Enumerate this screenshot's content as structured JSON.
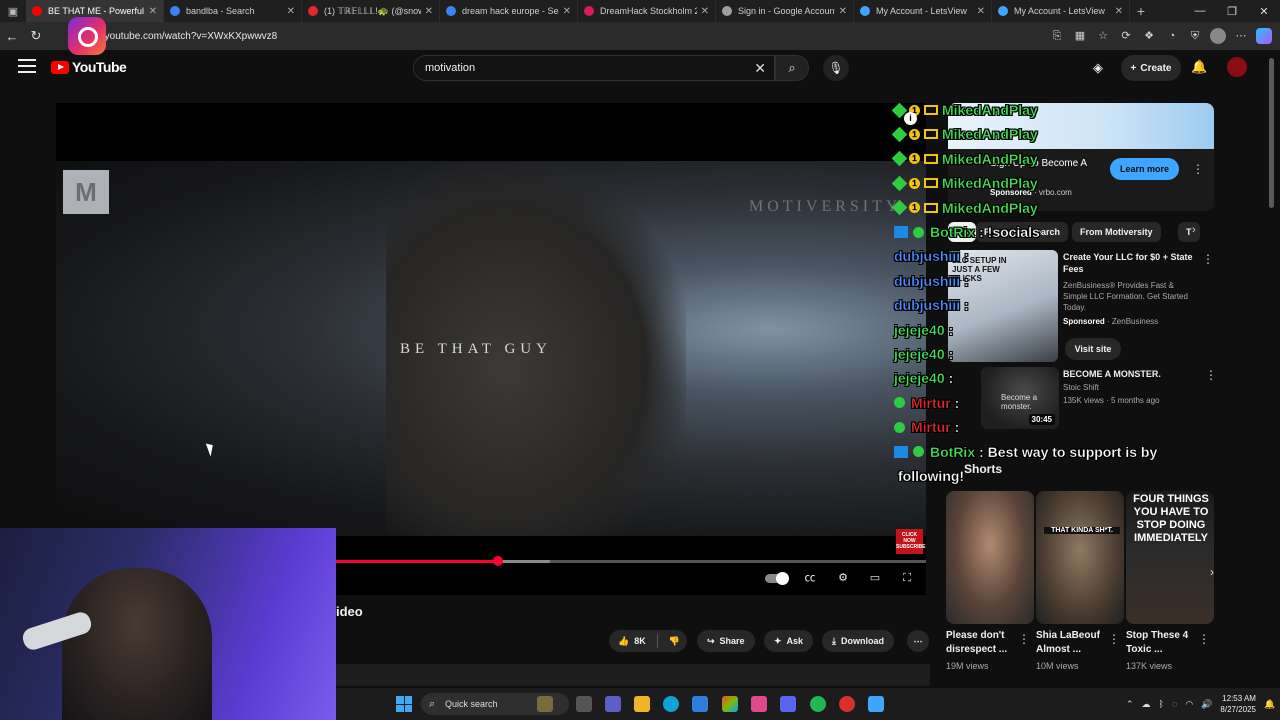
{
  "browser": {
    "tabs": [
      {
        "title": "BE THAT ME - Powerful Mo",
        "color": "#ff0000",
        "active": true
      },
      {
        "title": "bandlba - Search",
        "color": "#3b82f6",
        "active": false
      },
      {
        "title": "(1) 𝕋ℝ𝔼𝕃𝕃𝕃!🐢 (@snowbe",
        "color": "#e0282e",
        "active": false
      },
      {
        "title": "dream hack europe - Searc",
        "color": "#3b82f6",
        "active": false
      },
      {
        "title": "DreamHack Stockholm 202",
        "color": "#d81b60",
        "active": false
      },
      {
        "title": "Sign in - Google Accounts",
        "color": "#9e9e9e",
        "active": false
      },
      {
        "title": "My Account - LetsView",
        "color": "#3ea6ff",
        "active": false
      },
      {
        "title": "My Account - LetsView",
        "color": "#3ea6ff",
        "active": false
      }
    ],
    "url": "ww.youtube.com/watch?v=XWxKXpwwvz8"
  },
  "youtube": {
    "logo_text": "YouTube",
    "search_value": "motivation",
    "create_label": "Create"
  },
  "video": {
    "overlay_title": "BE THAT GUY",
    "watermark": "MOTIVERSITY",
    "logo_badge": "M",
    "progress_played": 0.275,
    "progress_loaded": 0.363,
    "click_now_badge": "CLICK NOW SUBSCRIBE",
    "title_visible_tail": "ideo"
  },
  "actions": {
    "like_count": "8K",
    "share_label": "Share",
    "ask_label": "Ask",
    "download_label": "Download"
  },
  "chat": [
    {
      "user": "MikedAndPlay",
      "msg": "",
      "color": "green",
      "badges": "icons"
    },
    {
      "user": "MikedAndPlay",
      "msg": "",
      "color": "green",
      "badges": "icons"
    },
    {
      "user": "MikedAndPlay",
      "msg": "",
      "color": "green",
      "badges": "icons"
    },
    {
      "user": "MikedAndPlay",
      "msg": "",
      "color": "green",
      "badges": "icons"
    },
    {
      "user": "MikedAndPlay",
      "msg": "",
      "color": "green",
      "badges": "icons"
    },
    {
      "user": "BotRix",
      "msg": ": !socials",
      "color": "green",
      "badges": "bot"
    },
    {
      "user": "dubjushiii",
      "msg": ":",
      "color": "blue",
      "badges": ""
    },
    {
      "user": "dubjushiii",
      "msg": ":",
      "color": "blue",
      "badges": ""
    },
    {
      "user": "dubjushiii",
      "msg": ":",
      "color": "blue",
      "badges": ""
    },
    {
      "user": "jejeje40",
      "msg": ":",
      "color": "green",
      "badges": ""
    },
    {
      "user": "jejeje40",
      "msg": ":",
      "color": "green",
      "badges": ""
    },
    {
      "user": "jejeje40",
      "msg": ":",
      "color": "green",
      "badges": ""
    },
    {
      "user": "Mirtur",
      "msg": ":",
      "color": "red",
      "badges": "check"
    },
    {
      "user": "Mirtur",
      "msg": ":",
      "color": "red",
      "badges": "check"
    },
    {
      "user": "BotRix",
      "msg": ": Best way to support is by",
      "color": "green",
      "badges": "bot"
    },
    {
      "user": "",
      "msg": "following!",
      "color": "white",
      "badges": ""
    }
  ],
  "ad": {
    "subtitle": "Sign Up To Become A",
    "sponsored": "Sponsored",
    "domain": "· vrbo.com",
    "learn_more": "Learn more"
  },
  "chips": [
    {
      "label": "All",
      "active": true
    },
    {
      "label": "From your search",
      "active": false
    },
    {
      "label": "From Motiversity",
      "active": false
    },
    {
      "label": "T",
      "active": false
    }
  ],
  "recommendations": [
    {
      "title": "Create Your LLC for $0 + State Fees",
      "desc": "ZenBusiness® Provides Fast & Simple LLC Formation. Get Started Today.",
      "sponsored": "Sponsored",
      "advertiser": "· ZenBusiness",
      "cta": "Visit site",
      "thumb_text": "LLC SETUP IN JUST A FEW CLICKS"
    },
    {
      "title": "BECOME A MONSTER.",
      "channel": "Stoic Shift",
      "meta": "135K views · 5 months ago",
      "duration": "30:45",
      "thumb_text": "Become a monster."
    }
  ],
  "shorts": {
    "label": "Shorts",
    "items": [
      {
        "title": "Please don't disrespect ...",
        "views": "19M views",
        "thumb_text": ""
      },
      {
        "title": "Shia LaBeouf Almost ...",
        "views": "10M views",
        "thumb_text": "THAT KINDA SH*T."
      },
      {
        "title": "Stop These 4 Toxic ...",
        "views": "137K views",
        "thumb_text": "FOUR THINGS YOU HAVE TO STOP DOING IMMEDIATELY"
      }
    ]
  },
  "taskbar": {
    "search_placeholder": "Quick search",
    "time": "12:53 AM",
    "date": "8/27/2025"
  }
}
